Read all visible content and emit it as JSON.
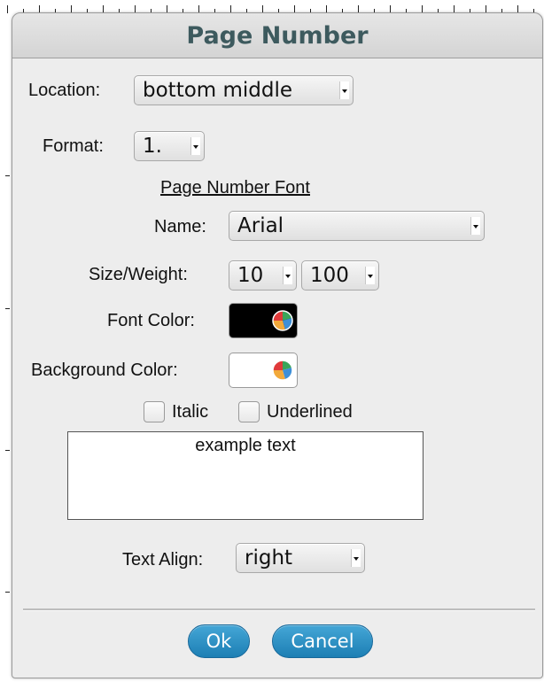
{
  "dialog": {
    "title": "Page Number",
    "location": {
      "label": "Location:",
      "value": "bottom middle"
    },
    "format": {
      "label": "Format:",
      "value": "1."
    },
    "font_section": {
      "heading": "Page Number Font",
      "name": {
        "label": "Name:",
        "value": "Arial"
      },
      "size_weight": {
        "label": "Size/Weight:",
        "size": "10",
        "weight": "100"
      },
      "font_color": {
        "label": "Font Color:",
        "color": "#000000"
      },
      "background_color": {
        "label": "Background Color:",
        "color": "#ffffff"
      }
    },
    "italic": {
      "label": "Italic",
      "checked": false
    },
    "underlined": {
      "label": "Underlined",
      "checked": false
    },
    "preview_text": "example text",
    "text_align": {
      "label": "Text Align:",
      "value": "right"
    },
    "buttons": {
      "ok": "Ok",
      "cancel": "Cancel"
    }
  },
  "colors": {
    "button_blue": "#2a8fc4",
    "title_text": "#3d5a5e",
    "dialog_bg": "#ededed"
  }
}
